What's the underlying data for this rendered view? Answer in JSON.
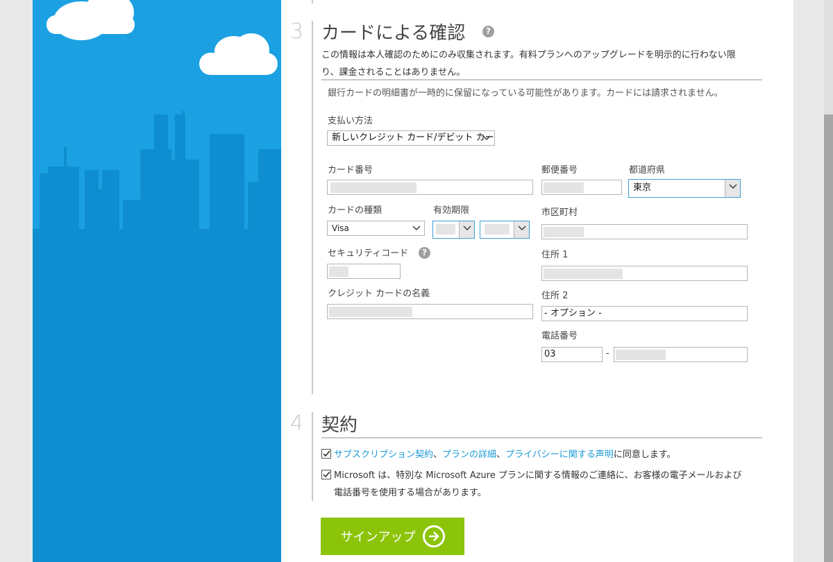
{
  "step3": {
    "number": "3",
    "title": "カードによる確認",
    "help": "?",
    "notice_line1": "この情報は本人確認のためにのみ収集されます。有料プランへのアップグレードを明示的に行わない限",
    "notice_line2": "り、課金されることはありません。",
    "sub_notice": "銀行カードの明細書が一時的に保留になっている可能性があります。カードには請求されません。"
  },
  "payment": {
    "method_label": "支払い方法",
    "method_value": "新しいクレジット カード/デビット カード",
    "card_number_label": "カード番号",
    "card_type_label": "カードの種類",
    "card_type_value": "Visa",
    "expiry_label": "有効期限",
    "security_code_label": "セキュリティコード",
    "security_help": "?",
    "cardholder_label": "クレジット カードの名義"
  },
  "address": {
    "postal_label": "郵便番号",
    "prefecture_label": "都道府県",
    "prefecture_value": "東京",
    "city_label": "市区町村",
    "address1_label": "住所 1",
    "address2_label": "住所 2",
    "address2_placeholder": "- オプション -",
    "phone_label": "電話番号",
    "phone_area": "03",
    "phone_sep": "-"
  },
  "step4": {
    "number": "4",
    "title": "契約",
    "link_subscription": "サブスクリプション契約",
    "sep1": "、",
    "link_plan": "プランの詳細",
    "sep2": "、",
    "link_privacy": "プライバシーに関する声明",
    "agree_suffix": "に同意します。",
    "contact_line1": "Microsoft は、特別な Microsoft Azure プランに関する情報のご連絡に、お客様の電子メールおよび",
    "contact_line2": "電話番号を使用する場合があります。"
  },
  "signup_label": "サインアップ",
  "colors": {
    "sky": "#1ba1e2",
    "building": "#0e8ed0",
    "accent_link": "#1a9ad6",
    "signup_button": "#8cc40a"
  }
}
